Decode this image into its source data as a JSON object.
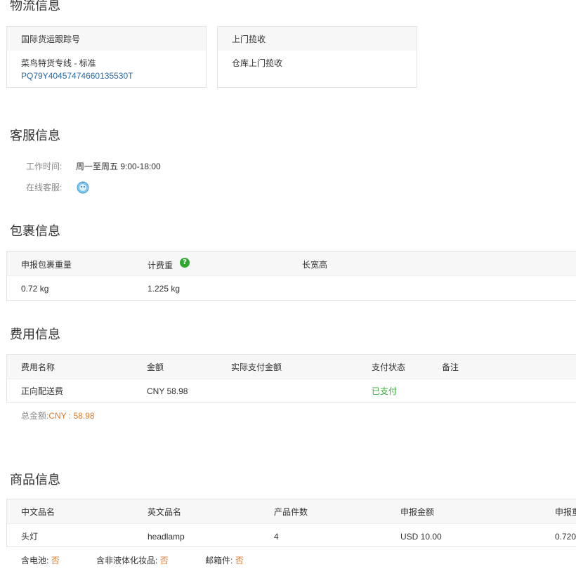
{
  "logistics": {
    "title": "物流信息",
    "tracking_card": {
      "header": "国际货运跟踪号",
      "line_name": "菜鸟特货专线 - 标准",
      "tracking_number": "PQ79Y40457474660135530T"
    },
    "pickup_card": {
      "header": "上门揽收",
      "value": "仓库上门揽收"
    }
  },
  "customer_service": {
    "title": "客服信息",
    "hours_label": "工作时间:",
    "hours_value": "周一至周五 9:00-18:00",
    "online_label": "在线客服:",
    "online_icon": "chat-bubble-icon"
  },
  "package": {
    "title": "包裹信息",
    "headers": [
      "申报包裹重量",
      "计费重",
      "长宽高"
    ],
    "row": [
      "0.72 kg",
      "1.225 kg",
      ""
    ],
    "help_glyph": "?"
  },
  "fees": {
    "title": "费用信息",
    "headers": [
      "费用名称",
      "金额",
      "实际支付金额",
      "支付状态",
      "备注"
    ],
    "row": [
      "正向配送费",
      "CNY 58.98",
      "",
      "已支付",
      ""
    ],
    "total_label": "总金额:",
    "total_value": "CNY : 58.98"
  },
  "goods": {
    "title": "商品信息",
    "headers": [
      "中文品名",
      "英文品名",
      "产品件数",
      "申报金额",
      "申报重"
    ],
    "row": [
      "头灯",
      "headlamp",
      "4",
      "USD 10.00",
      "0.720"
    ],
    "flags": [
      {
        "label": "含电池:",
        "value": "否"
      },
      {
        "label": "含非液体化妆品:",
        "value": "否"
      },
      {
        "label": "邮箱件:",
        "value": "否"
      }
    ]
  },
  "colors": {
    "link": "#2b6aa6",
    "paid": "#3aa83a",
    "highlight": "#e07b2b",
    "help_icon": "#2fa82f"
  }
}
